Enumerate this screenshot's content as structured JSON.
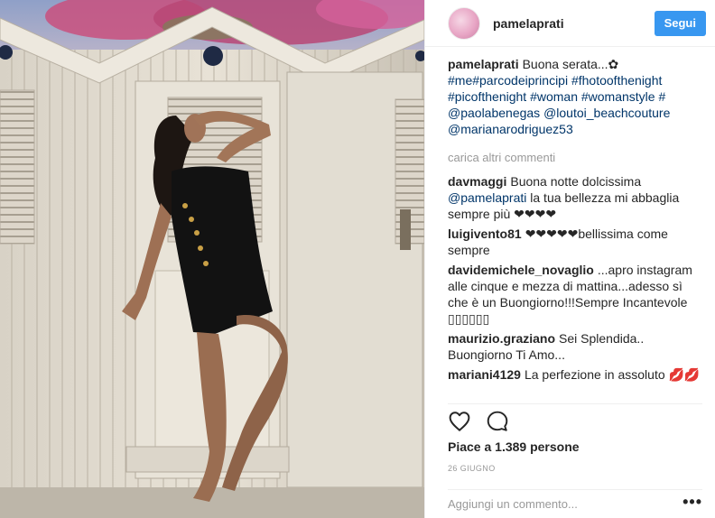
{
  "post": {
    "username": "pamelaprati",
    "follow_label": "Segui",
    "caption": {
      "username": "pamelaprati",
      "text": "Buona serata...✿",
      "hashtags": "#me#parcodeiprincipi #fhotoofthenight #picofthenight #woman #womanstyle #",
      "mentions": "@paolabenegas @loutoi_beachcouture @marianarodriguez53"
    },
    "load_more": "carica altri commenti",
    "comments": [
      {
        "username": "davmaggi",
        "pre": "Buona notte dolcissima",
        "mention": "@pamelaprati",
        "post": " la tua bellezza mi abbaglia sempre più ❤❤❤❤"
      },
      {
        "username": "luigivento81",
        "text": "❤❤❤❤❤bellissima come sempre"
      },
      {
        "username": "davidemichele_novaglio",
        "text": "...apro instagram alle cinque e mezza di mattina...adesso sì che è un Buongiorno!!!Sempre Incantevole ▯▯▯▯▯▯"
      },
      {
        "username": "maurizio.graziano",
        "text": "Sei Splendida.. Buongiorno Ti Amo..."
      },
      {
        "username": "mariani4129",
        "text": "La perfezione in assoluto 💋💋"
      }
    ],
    "likes": "Piace a 1.389 persone",
    "date": "26 GIUGNO",
    "add_comment_placeholder": "Aggiungi un commento...",
    "more_label": "•••"
  },
  "icons": {
    "like": "heart-icon",
    "comment": "speech-bubble-icon",
    "more": "ellipsis-icon"
  },
  "colors": {
    "follow_button": "#3897f0",
    "link": "#003569",
    "muted": "#999999"
  }
}
